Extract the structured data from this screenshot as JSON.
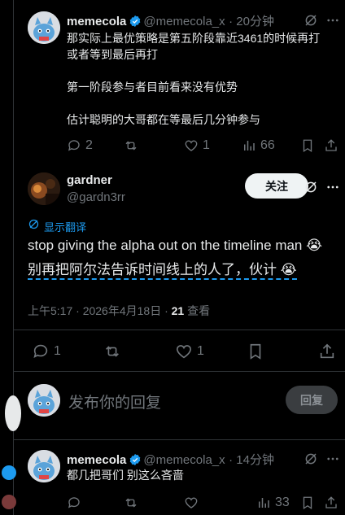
{
  "colors": {
    "background": "#000000",
    "text": "#e7e9ea",
    "muted": "#71767b",
    "accent": "#1d9bf0",
    "border": "#2f3336"
  },
  "post1": {
    "name": "memecola",
    "handle": "@memecola_x",
    "time": "· 20分钟",
    "text": "那实际上最优策略是第五阶段靠近3461的时候再打\n或者等到最后再打\n\n第一阶段参与者目前看来没有优势\n\n估计聪明的大哥都在等最后几分钟参与",
    "replies": "2",
    "likes": "1",
    "views": "66"
  },
  "main": {
    "name": "gardner",
    "handle": "@gardn3rr",
    "follow_label": "关注",
    "translate_label": "显示翻译",
    "text": "stop giving the alpha out on the timeline man 😭",
    "translation": "别再把阿尔法告诉时间线上的人了，伙计 😭",
    "timestamp": "上午5:17 · 2026年4月18日 · ",
    "views_count": "21",
    "views_label": " 查看",
    "replies": "1",
    "likes": "1"
  },
  "composer": {
    "placeholder": "发布你的回复",
    "button_label": "回复"
  },
  "post2": {
    "name": "memecola",
    "handle": "@memecola_x",
    "time": "· 14分钟",
    "text": "都几把哥们 别这么吝啬",
    "views": "33"
  },
  "icons": [
    "verified-icon",
    "grok-icon",
    "more-icon",
    "reply-icon",
    "retweet-icon",
    "like-icon",
    "views-icon",
    "bookmark-icon",
    "share-icon",
    "translate-icon"
  ]
}
